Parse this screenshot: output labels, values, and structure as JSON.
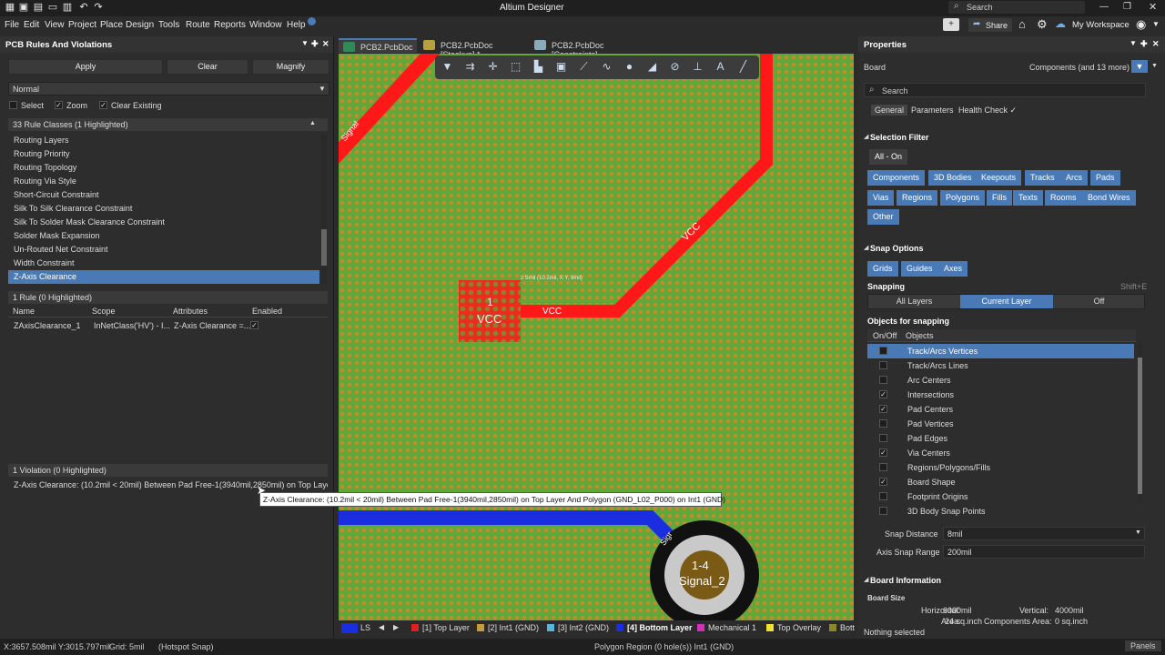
{
  "app": {
    "title": "Altium Designer",
    "search_placeholder": "Search"
  },
  "menu": [
    "File",
    "Edit",
    "View",
    "Project",
    "Place",
    "Design",
    "Tools",
    "Route",
    "Reports",
    "Window",
    "Help"
  ],
  "header_right": {
    "share": "Share",
    "workspace": "My Workspace"
  },
  "left_panel": {
    "title": "PCB Rules And Violations",
    "apply": "Apply",
    "clear": "Clear",
    "magnify": "Magnify",
    "mode": "Normal",
    "opt_select": "Select",
    "opt_zoom": "Zoom",
    "opt_clear_existing": "Clear Existing",
    "rule_classes_header": "33 Rule Classes (1 Highlighted)",
    "rule_classes": [
      "Routing Layers",
      "Routing Priority",
      "Routing Topology",
      "Routing Via Style",
      "Short-Circuit Constraint",
      "Silk To Silk Clearance Constraint",
      "Silk To Solder Mask Clearance Constraint",
      "Solder Mask Expansion",
      "Un-Routed Net Constraint",
      "Width Constraint",
      "Z-Axis Clearance"
    ],
    "rules_header": "1 Rule (0 Highlighted)",
    "rule_cols": [
      "Name",
      "Scope",
      "Attributes",
      "Enabled"
    ],
    "rule_row": {
      "name": "ZAxisClearance_1",
      "scope": "InNetClass('HV') - I...",
      "attributes": "Z-Axis Clearance =...",
      "enabled": "✓"
    },
    "violations_header": "1 Violation (0 Highlighted)",
    "violation": "Z-Axis Clearance: (10.2mil < 20mil) Between Pad Free-1(3940mil,2850mil) on Top Layer A..."
  },
  "tooltip": "Z-Axis Clearance: (10.2mil < 20mil) Between Pad Free-1(3940mil,2850mil) on Top Layer And Polygon  (GND_L02_P000) on Int1 (GND)",
  "doc_tabs": [
    "PCB2.PcbDoc *",
    "PCB2.PcbDoc [Stackup] *",
    "PCB2.PcbDoc [Constraints]"
  ],
  "canvas": {
    "signal_top": "Signal",
    "vcc_diag": "VCC",
    "vcc_track": "VCC",
    "pad_label": "VCC",
    "pad_number": "1",
    "pad_dim": "z:Smil (10.2mil, X:Y, 9mil)",
    "via_num": "1-4",
    "via_net": "Signal_2",
    "blue_label": "Sigr"
  },
  "layer_tabs": {
    "ls": "LS",
    "items": [
      "[1] Top Layer",
      "[2] Int1 (GND)",
      "[3] Int2 (GND)",
      "[4] Bottom Layer",
      "Mechanical 1",
      "Top Overlay",
      "Bott"
    ]
  },
  "colors": {
    "top": "#e02020",
    "int1": "#c89a3a",
    "int2": "#58b5e0",
    "bottom": "#1a2ee0",
    "mech": "#d030c0",
    "overlay": "#f0e030",
    "bott": "#8a8a2a",
    "accent": "#4a7ab5"
  },
  "properties": {
    "title": "Properties",
    "board": "Board",
    "components": "Components (and 13 more)",
    "search": "Search",
    "tabs": [
      "General",
      "Parameters",
      "Health Check ✓"
    ],
    "selection_filter": "Selection Filter",
    "all_on": "All - On",
    "filters": [
      "Components",
      "3D Bodies",
      "Keepouts",
      "Tracks",
      "Arcs",
      "Pads",
      "Vias",
      "Regions",
      "Polygons",
      "Fills",
      "Texts",
      "Rooms",
      "Bond Wires",
      "Other"
    ],
    "snap_options": "Snap Options",
    "snap_btns": [
      "Grids",
      "Guides",
      "Axes"
    ],
    "snapping": "Snapping",
    "snapping_shortcut": "Shift+E",
    "snap_layers": [
      "All Layers",
      "Current Layer",
      "Off"
    ],
    "objects_for_snapping": "Objects for snapping",
    "obj_cols": [
      "On/Off",
      "Objects"
    ],
    "objects": [
      {
        "n": "Track/Arcs Vertices",
        "c": ""
      },
      {
        "n": "Track/Arcs Lines",
        "c": ""
      },
      {
        "n": "Arc Centers",
        "c": ""
      },
      {
        "n": "Intersections",
        "c": "✓"
      },
      {
        "n": "Pad Centers",
        "c": "✓"
      },
      {
        "n": "Pad Vertices",
        "c": ""
      },
      {
        "n": "Pad Edges",
        "c": ""
      },
      {
        "n": "Via Centers",
        "c": "✓"
      },
      {
        "n": "Regions/Polygons/Fills",
        "c": ""
      },
      {
        "n": "Board Shape",
        "c": "✓"
      },
      {
        "n": "Footprint Origins",
        "c": ""
      },
      {
        "n": "3D Body Snap Points",
        "c": ""
      }
    ],
    "snap_distance_label": "Snap Distance",
    "snap_distance": "8mil",
    "axis_snap_label": "Axis Snap Range",
    "axis_snap": "200mil",
    "board_info": "Board Information",
    "board_size": "Board Size",
    "horizontal_label": "Horizontal:",
    "horizontal": "6000mil",
    "vertical_label": "Vertical:",
    "vertical": "4000mil",
    "area_label": "Area:",
    "area": "24 sq.inch",
    "comp_area_label": "Components Area:",
    "comp_area": "0 sq.inch",
    "nothing_selected": "Nothing selected"
  },
  "status": {
    "coords": "X:3657.508mil Y:3015.797mil",
    "grid": "Grid: 5mil",
    "hotspot": "(Hotspot Snap)",
    "center": "Polygon Region (0 hole(s)) Int1 (GND)",
    "panels": "Panels"
  }
}
